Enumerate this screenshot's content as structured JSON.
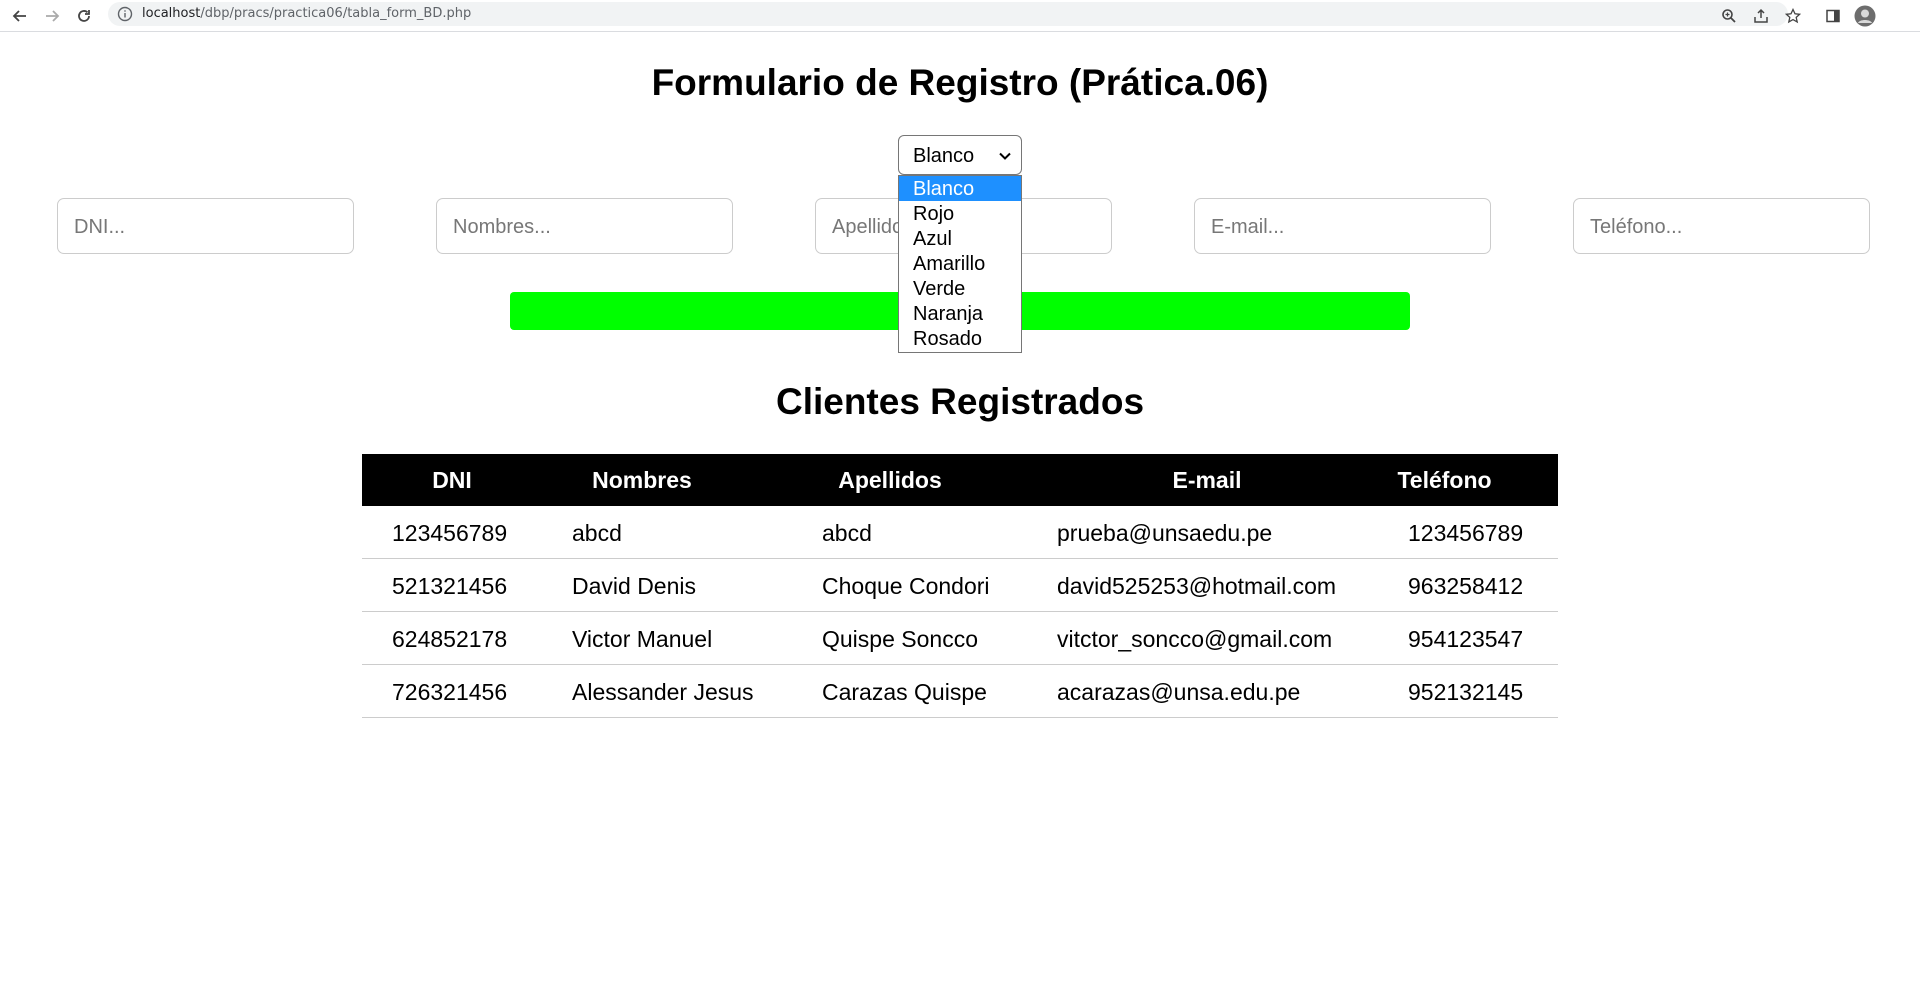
{
  "browser": {
    "url_host": "localhost",
    "url_path": "/dbp/pracs/practica06/tabla_form_BD.php"
  },
  "page": {
    "title": "Formulario de Registro (Prática.06)",
    "section_title": "Clientes Registrados"
  },
  "color_select": {
    "value": "Blanco",
    "options": [
      "Blanco",
      "Rojo",
      "Azul",
      "Amarillo",
      "Verde",
      "Naranja",
      "Rosado"
    ],
    "selected_index": 0
  },
  "form": {
    "dni_placeholder": "DNI...",
    "nombres_placeholder": "Nombres...",
    "apellidos_placeholder": "Apellidos...",
    "email_placeholder": "E-mail...",
    "telefono_placeholder": "Teléfono..."
  },
  "submit_color": "#00ff00",
  "table": {
    "headers": [
      "DNI",
      "Nombres",
      "Apellidos",
      "E-mail",
      "Teléfono"
    ],
    "rows": [
      [
        "123456789",
        "abcd",
        "abcd",
        "prueba@unsaedu.pe",
        "123456789"
      ],
      [
        "521321456",
        "David Denis",
        "Choque Condori",
        "david525253@hotmail.com",
        "963258412"
      ],
      [
        "624852178",
        "Victor Manuel",
        "Quispe Soncco",
        "vitctor_soncco@gmail.com",
        "954123547"
      ],
      [
        "726321456",
        "Alessander Jesus",
        "Carazas Quispe",
        "acarazas@unsa.edu.pe",
        "952132145"
      ]
    ]
  },
  "icons": {
    "back": "arrow-left-icon",
    "forward": "arrow-right-icon",
    "reload": "reload-icon",
    "info": "info-icon",
    "zoom": "zoom-icon",
    "share": "share-icon",
    "bookmark": "star-icon",
    "sidepanel": "side-panel-icon",
    "profile": "avatar-icon"
  }
}
